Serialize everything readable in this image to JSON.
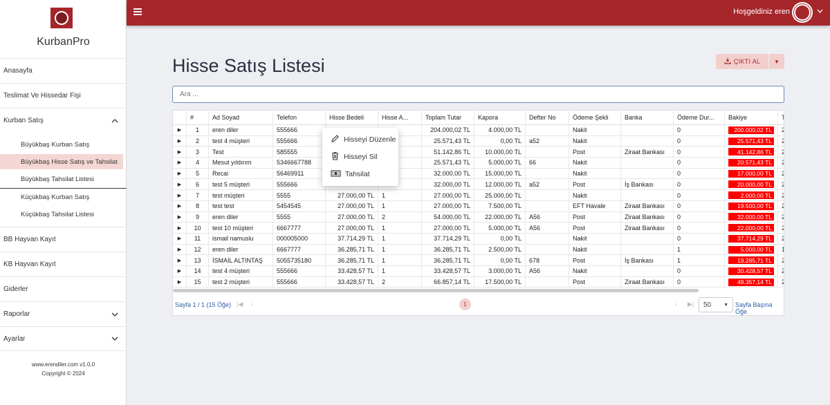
{
  "app": {
    "name": "KurbanPro"
  },
  "sidebar": {
    "items": [
      {
        "label": "Anasayfa"
      },
      {
        "label": "Teslimat Ve Hissedar Fişi"
      },
      {
        "label": "Kurban Satış",
        "icon": "chevron-up-icon"
      },
      {
        "label": "BB Hayvan Kayıt"
      },
      {
        "label": "KB Hayvan Kayıt"
      },
      {
        "label": "Giderler"
      },
      {
        "label": "Raporlar",
        "icon": "chevron-down-icon"
      },
      {
        "label": "Ayarlar",
        "icon": "chevron-down-icon"
      }
    ],
    "sub_items": [
      {
        "label": "Büyükbaş Kurban Satış"
      },
      {
        "label": "Büyükbaş Hisse Satış ve Tahsilat",
        "active": true
      },
      {
        "label": "Büyükbaş Tahsilat Listesi"
      },
      {
        "label": "Küçükbaş Kurban Satış"
      },
      {
        "label": "Küçükbaş Tahsilat Listesi"
      }
    ],
    "footer": {
      "site": "www.erendiler.com v1.0.0",
      "copyright": "Copyright © 2024"
    }
  },
  "topbar": {
    "welcome": "Hoşgeldiniz eren",
    "accent": "#a5262b"
  },
  "page": {
    "title": "Hisse Satış Listesi",
    "print_label": "ÇIKTI AL",
    "search_placeholder": "Ara ..."
  },
  "table": {
    "columns": [
      "",
      "#",
      "Ad Soyad",
      "Telefon",
      "Hisse Bedeli",
      "Hisse A...",
      "Toplam Tutar",
      "Kapora",
      "Defter No",
      "Ödeme Şekli",
      "Banka",
      "Ödeme Dur...",
      "Bakiye",
      "T"
    ],
    "rows": [
      {
        "no": "1",
        "name": "eren diler",
        "phone": "555666",
        "price": "",
        "shares": "",
        "total": "204.000,02 TL",
        "deposit": "4.000,00 TL",
        "book": "",
        "method": "Nakit",
        "bank": "",
        "status": "0",
        "balance": "200.000,02 TL",
        "t": "2"
      },
      {
        "no": "2",
        "name": "test 4 müşteri",
        "phone": "555666",
        "price": "",
        "shares": "",
        "total": "25.571,43 TL",
        "deposit": "0,00 TL",
        "book": "a52",
        "method": "Nakit",
        "bank": "",
        "status": "0",
        "balance": "25.571,43 TL",
        "t": "2"
      },
      {
        "no": "3",
        "name": "Test",
        "phone": "585555",
        "price": "",
        "shares": "",
        "total": "51.142,86 TL",
        "deposit": "10.000,00 TL",
        "book": "",
        "method": "Post",
        "bank": "Ziraat Bankası",
        "status": "0",
        "balance": "41.142,86 TL",
        "t": "2"
      },
      {
        "no": "4",
        "name": "Mesut yıldırım",
        "phone": "5346667788",
        "price": "",
        "shares": "",
        "total": "25.571,43 TL",
        "deposit": "5.000,00 TL",
        "book": "66",
        "method": "Nakit",
        "bank": "",
        "status": "0",
        "balance": "20.571,43 TL",
        "t": "2"
      },
      {
        "no": "5",
        "name": "Recai",
        "phone": "56469911",
        "price": "",
        "shares": "",
        "total": "32.000,00 TL",
        "deposit": "15.000,00 TL",
        "book": "",
        "method": "Nakit",
        "bank": "",
        "status": "0",
        "balance": "17.000,00 TL",
        "t": "2"
      },
      {
        "no": "6",
        "name": "test 5 müşteri",
        "phone": "555666",
        "price": "",
        "shares": "",
        "total": "32.000,00 TL",
        "deposit": "12.000,00 TL",
        "book": "a52",
        "method": "Post",
        "bank": "İş Bankası",
        "status": "0",
        "balance": "20.000,00 TL",
        "t": "2"
      },
      {
        "no": "7",
        "name": "test müşteri",
        "phone": "5555",
        "price": "27.000,00 TL",
        "shares": "1",
        "total": "27.000,00 TL",
        "deposit": "25.000,00 TL",
        "book": "",
        "method": "Nakit",
        "bank": "",
        "status": "0",
        "balance": "2.000,00 TL",
        "t": "2"
      },
      {
        "no": "8",
        "name": "test test",
        "phone": "5454545",
        "price": "27.000,00 TL",
        "shares": "1",
        "total": "27.000,00 TL",
        "deposit": "7.500,00 TL",
        "book": "",
        "method": "EFT Havale",
        "bank": "Ziraat Bankası",
        "status": "0",
        "balance": "19.500,00 TL",
        "t": "2"
      },
      {
        "no": "9",
        "name": "eren diler",
        "phone": "5555",
        "price": "27.000,00 TL",
        "shares": "2",
        "total": "54.000,00 TL",
        "deposit": "22.000,00 TL",
        "book": "A56",
        "method": "Post",
        "bank": "Ziraat Bankası",
        "status": "0",
        "balance": "32.000,00 TL",
        "t": "2"
      },
      {
        "no": "10",
        "name": "test 10 müşteri",
        "phone": "6667777",
        "price": "27.000,00 TL",
        "shares": "1",
        "total": "27.000,00 TL",
        "deposit": "5.000,00 TL",
        "book": "A56",
        "method": "Post",
        "bank": "Ziraat Bankası",
        "status": "0",
        "balance": "22.000,00 TL",
        "t": "2"
      },
      {
        "no": "11",
        "name": "ismail namuslu",
        "phone": "000005000",
        "price": "37.714,29 TL",
        "shares": "1",
        "total": "37.714,29 TL",
        "deposit": "0,00 TL",
        "book": "",
        "method": "Nakit",
        "bank": "",
        "status": "0",
        "balance": "37.714,29 TL",
        "t": "2"
      },
      {
        "no": "12",
        "name": "eren diler",
        "phone": "6667777",
        "price": "36.285,71 TL",
        "shares": "1",
        "total": "36.285,71 TL",
        "deposit": "2.500,00 TL",
        "book": "",
        "method": "Nakit",
        "bank": "",
        "status": "1",
        "balance": "5.000,00 TL",
        "t": "1"
      },
      {
        "no": "13",
        "name": "İSMAİL ALTINTAŞ",
        "phone": "5055735180",
        "price": "36.285,71 TL",
        "shares": "1",
        "total": "36.285,71 TL",
        "deposit": "0,00 TL",
        "book": "678",
        "method": "Post",
        "bank": "İş Bankası",
        "status": "1",
        "balance": "19.285,71 TL",
        "t": "2"
      },
      {
        "no": "14",
        "name": "test 4 müşteri",
        "phone": "555666",
        "price": "33.428,57 TL",
        "shares": "1",
        "total": "33.428,57 TL",
        "deposit": "3.000,00 TL",
        "book": "A56",
        "method": "Nakit",
        "bank": "",
        "status": "0",
        "balance": "30.428,57 TL",
        "t": "2"
      },
      {
        "no": "15",
        "name": "test 2 müşteri",
        "phone": "555666",
        "price": "33.428,57 TL",
        "shares": "2",
        "total": "66.857,14 TL",
        "deposit": "17.500,00 TL",
        "book": "",
        "method": "Post",
        "bank": "Ziraat Bankası",
        "status": "0",
        "balance": "49.357,14 TL",
        "t": "2"
      }
    ],
    "balance_color": "#ff0000"
  },
  "pager": {
    "info": "Sayfa 1 / 1 (15 Öğe)",
    "current_page": "1",
    "page_size": "50",
    "page_size_label": "Sayfa Başına Öğe"
  },
  "context_menu": {
    "items": [
      {
        "label": "Hisseyi Düzenle",
        "icon": "pencil-icon"
      },
      {
        "label": "Hisseyi Sil",
        "icon": "trash-icon"
      },
      {
        "label": "Tahsilat",
        "icon": "cash-icon"
      }
    ]
  }
}
